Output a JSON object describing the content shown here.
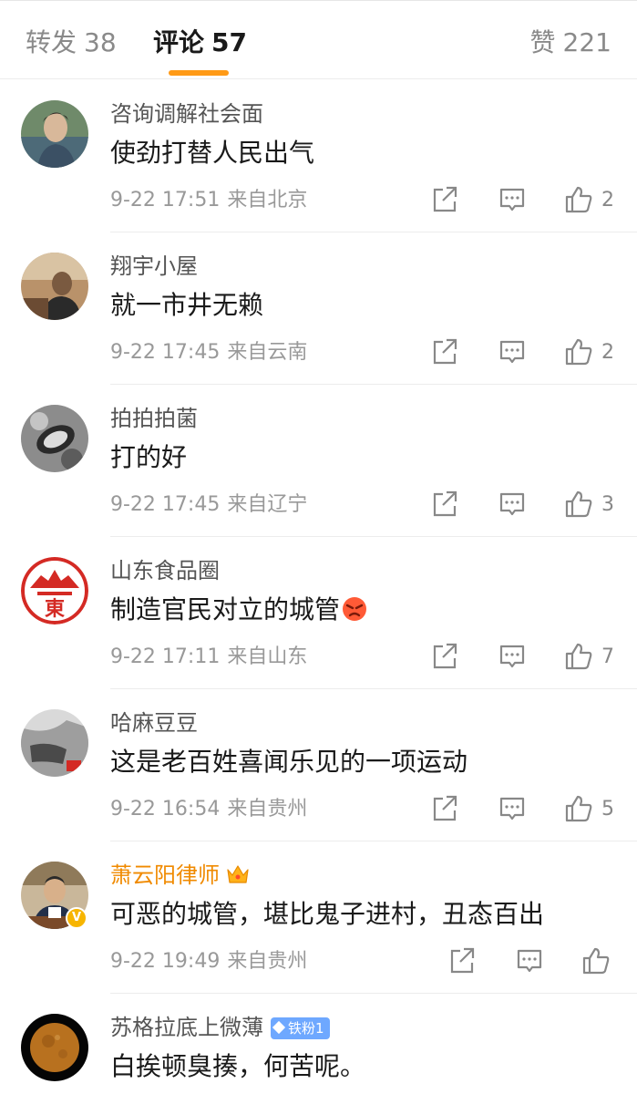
{
  "tabs": {
    "repost": {
      "label": "转发",
      "count": "38"
    },
    "comment": {
      "label": "评论",
      "count": "57"
    },
    "like": {
      "label": "赞",
      "count": "221"
    }
  },
  "comments": [
    {
      "author": "咨询调解社会面",
      "text": "使劲打替人民出气",
      "time": "9-22 17:51",
      "source": "来自北京",
      "likes": "2"
    },
    {
      "author": "翔宇小屋",
      "text": "就一市井无赖",
      "time": "9-22 17:45",
      "source": "来自云南",
      "likes": "2"
    },
    {
      "author": "拍拍拍菌",
      "text": "打的好",
      "time": "9-22 17:45",
      "source": "来自辽宁",
      "likes": "3"
    },
    {
      "author": "山东食品圈",
      "text": "制造官民对立的城管",
      "time": "9-22 17:11",
      "source": "来自山东",
      "likes": "7"
    },
    {
      "author": "哈麻豆豆",
      "text": "这是老百姓喜闻乐见的一项运动",
      "time": "9-22 16:54",
      "source": "来自贵州",
      "likes": "5"
    },
    {
      "author": "萧云阳律师",
      "text": "可恶的城管，堪比鬼子进村，丑态百出",
      "time": "9-22 19:49",
      "source": "来自贵州",
      "likes": ""
    },
    {
      "author": "苏格拉底上微薄",
      "badge": "铁粉1",
      "text": "白挨顿臭揍，何苦呢。",
      "time": "",
      "source": "",
      "likes": ""
    }
  ],
  "logo_text": "東",
  "colors": {
    "accent": "#ff9a16",
    "vip_name": "#f08a00",
    "fan_badge": "#6ea8ff",
    "meta": "#999999"
  },
  "icons": [
    "share-icon",
    "reply-icon",
    "like-icon",
    "crown-icon",
    "verified-icon",
    "angry-emoji-icon"
  ]
}
